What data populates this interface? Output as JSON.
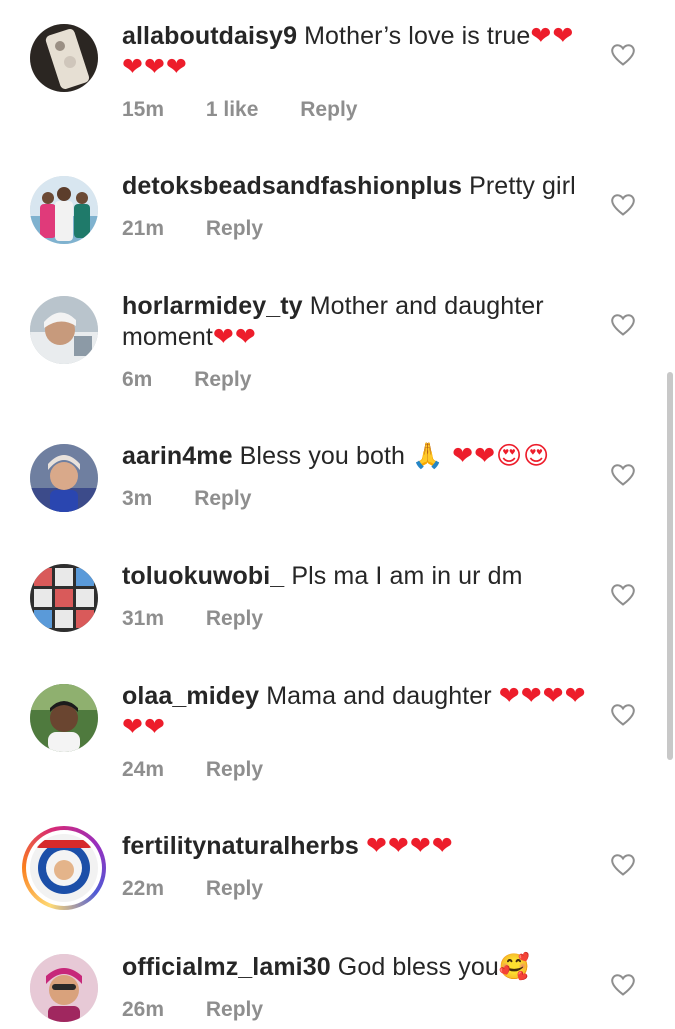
{
  "comments": [
    {
      "username": "allaboutdaisy9",
      "text": "Mother’s love is true",
      "emoji": "❤❤❤❤❤",
      "time": "15m",
      "likes": "1 like",
      "reply": "Reply"
    },
    {
      "username": "detoksbeadsandfashionplus",
      "text": "Pretty girl",
      "emoji": "",
      "time": "21m",
      "likes": "",
      "reply": "Reply"
    },
    {
      "username": "horlarmidey_ty",
      "text": "Mother and daughter moment",
      "emoji": "❤❤",
      "time": "6m",
      "likes": "",
      "reply": "Reply"
    },
    {
      "username": "aarin4me",
      "text": "Bless you both",
      "emoji": "🙏 ❤❤😍😍",
      "time": "3m",
      "likes": "",
      "reply": "Reply"
    },
    {
      "username": "toluokuwobi_",
      "text": "Pls ma I am in ur dm",
      "emoji": "",
      "time": "31m",
      "likes": "",
      "reply": "Reply"
    },
    {
      "username": "olaa_midey",
      "text": "Mama and daughter",
      "emoji": "❤❤❤❤❤❤",
      "time": "24m",
      "likes": "",
      "reply": "Reply"
    },
    {
      "username": "fertilitynaturalherbs",
      "text": "",
      "emoji": "❤❤❤❤",
      "time": "22m",
      "likes": "",
      "reply": "Reply"
    },
    {
      "username": "officialmz_lami30",
      "text": "God bless you",
      "emoji": "🥰",
      "time": "26m",
      "likes": "",
      "reply": "Reply"
    }
  ],
  "icons": {
    "like": "heart-outline-icon"
  },
  "colors": {
    "text": "#262626",
    "meta": "#8e8e8e",
    "heart_emoji": "#ed1d2b"
  }
}
